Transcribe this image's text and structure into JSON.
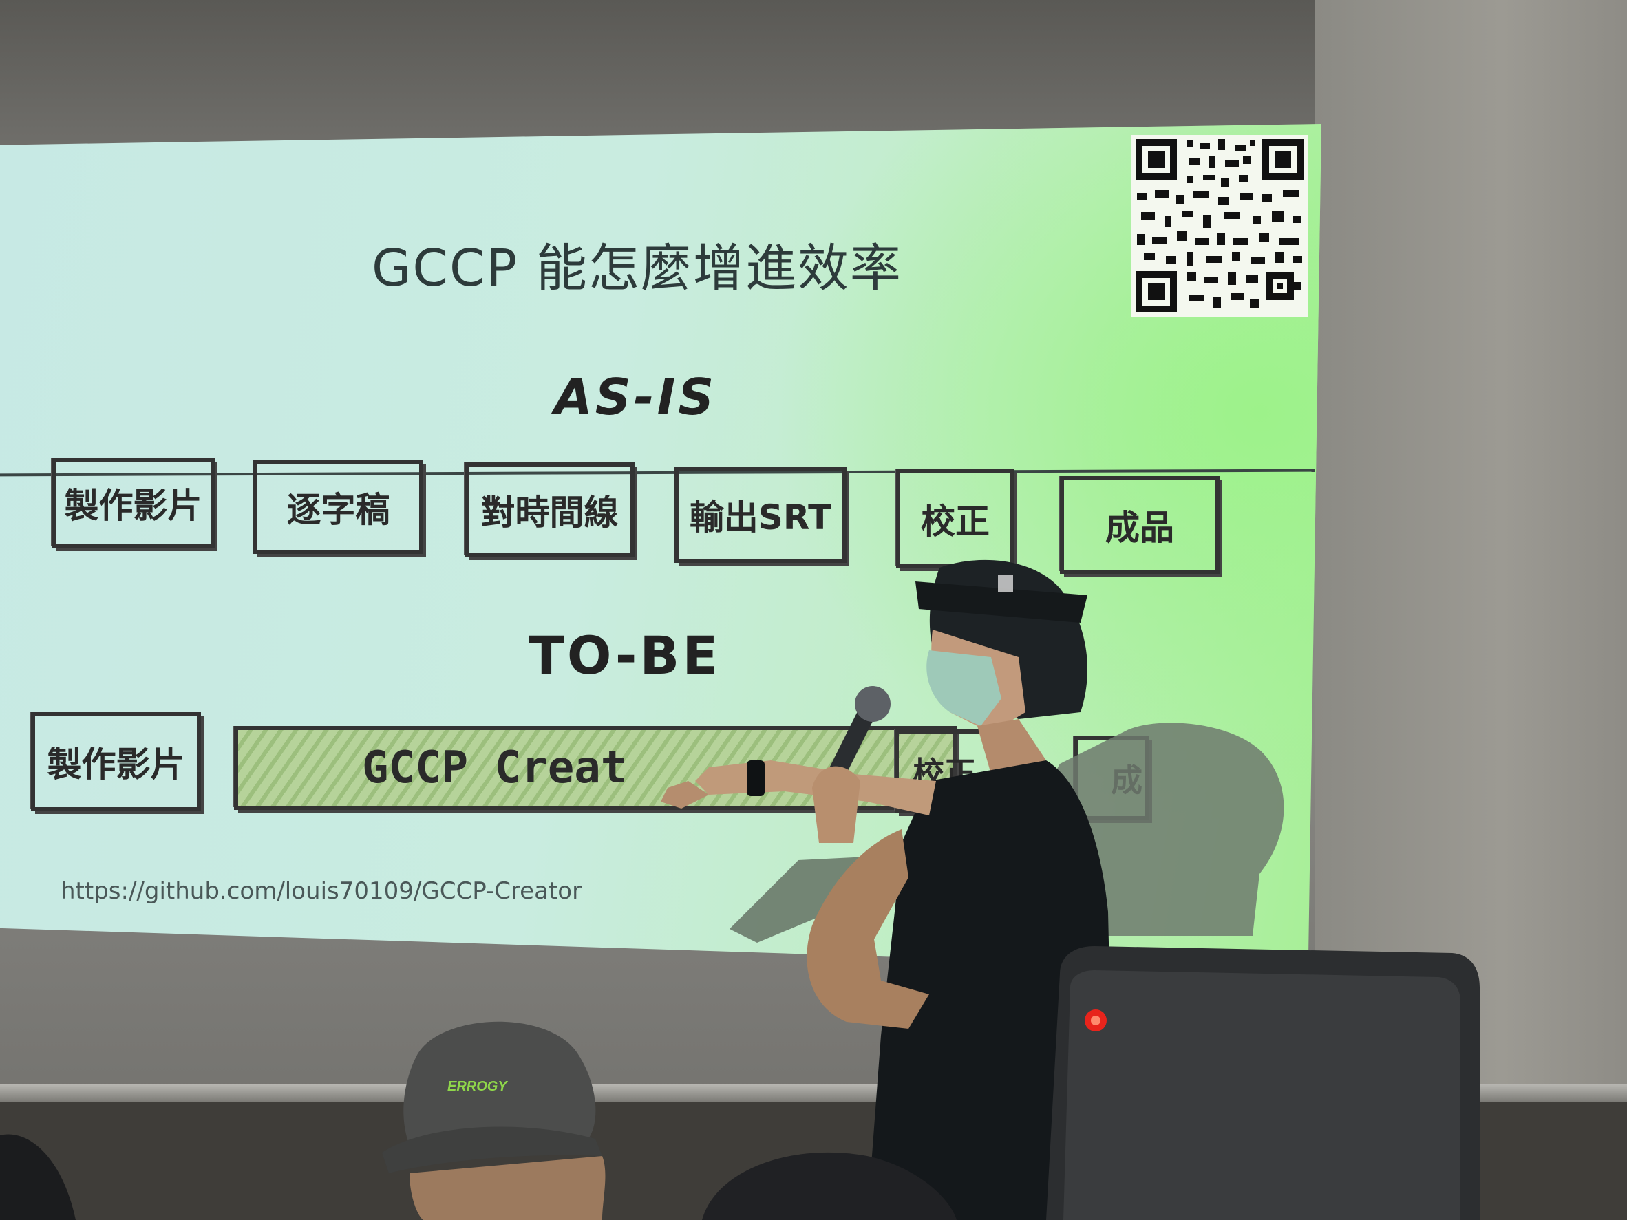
{
  "slide": {
    "title": "GCCP 能怎麼增進效率",
    "as_is_heading": "AS-IS",
    "to_be_heading": "TO-BE",
    "as_is_steps": [
      "製作影片",
      "逐字稿",
      "對時間線",
      "輸出SRT",
      "校正",
      "成品"
    ],
    "to_be_steps": [
      "製作影片",
      "GCCP Creat",
      "校正",
      "成"
    ],
    "url": "https://github.com/louis70109/GCCP-Creator"
  },
  "scene": {
    "slide_tint": "#c7e9e4",
    "glow": "#9df28a",
    "cap_logo_text": "ERROGY",
    "recording_light": "#e8241c"
  }
}
